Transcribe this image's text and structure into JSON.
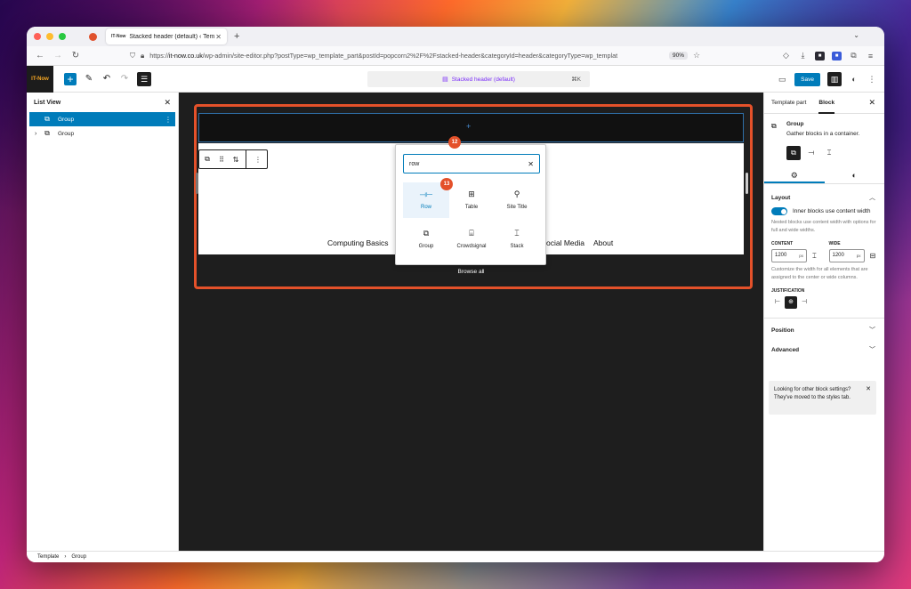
{
  "browser": {
    "tab_title": "Stacked header (default) ‹ Tem",
    "tab_favicon": "IT-Now",
    "url_prefix": "https://",
    "url_host": "it-now.co.uk",
    "url_path": "/wp-admin/site-editor.php?postType=wp_template_part&postId=popcorn2%2F%2Fstacked-header&categoryId=header&categoryType=wp_templat",
    "zoom": "90%"
  },
  "wp_toolbar": {
    "logo_text": "IT-Now",
    "document_title": "Stacked header (default)",
    "shortcut": "⌘K",
    "save_label": "Save"
  },
  "list_view": {
    "title": "List View",
    "items": [
      {
        "label": "Group",
        "selected": true
      },
      {
        "label": "Group",
        "selected": false
      }
    ]
  },
  "canvas": {
    "nav_links": [
      "Computing Basics",
      "ocial Media",
      "About"
    ],
    "browse_all": "Browse all",
    "badges": [
      "12",
      "13"
    ]
  },
  "inserter": {
    "search_value": "row",
    "results": [
      {
        "label": "Row",
        "icon": "row-icon"
      },
      {
        "label": "Table",
        "icon": "table-icon"
      },
      {
        "label": "Site Title",
        "icon": "map-pin-icon"
      },
      {
        "label": "Group",
        "icon": "group-icon"
      },
      {
        "label": "Crowdsignal",
        "icon": "crowdsignal-icon"
      },
      {
        "label": "Stack",
        "icon": "stack-icon"
      }
    ]
  },
  "settings": {
    "tab_template_part": "Template part",
    "tab_block": "Block",
    "block_title": "Group",
    "block_desc": "Gather blocks in a container.",
    "layout_title": "Layout",
    "toggle_label": "Inner blocks use content width",
    "toggle_help": "Nested blocks use content width with options for full and wide widths.",
    "content_label": "CONTENT",
    "content_value": "1200",
    "wide_label": "WIDE",
    "wide_value": "1200",
    "unit": "px",
    "width_help": "Customize the width for all elements that are assigned to the center or wide columns.",
    "justification_label": "JUSTIFICATION",
    "position_title": "Position",
    "advanced_title": "Advanced",
    "notice": "Looking for other block settings? They've moved to the styles tab."
  },
  "footer": {
    "crumb1": "Template",
    "crumb2": "Group"
  },
  "colors": {
    "accent": "#007cba",
    "annotation": "#e4512a",
    "canvas_bg": "#1e1e1e"
  }
}
